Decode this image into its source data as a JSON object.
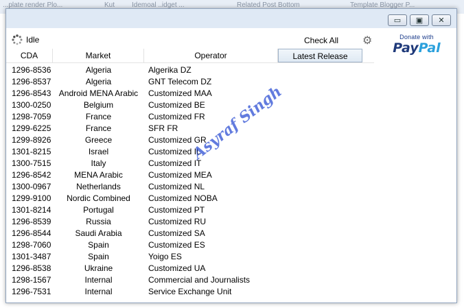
{
  "background_tabs": [
    "...plate render Plo...",
    "Kut",
    "Idemoal ..idget ...",
    "Related Post Bottom",
    "Template Blogger P..."
  ],
  "window": {
    "buttons": {
      "minimize": "▭",
      "maximize": "▣",
      "close": "✕"
    }
  },
  "status": {
    "text": "Idle",
    "icon": "spinner-icon"
  },
  "toolbar": {
    "check_all": "Check All",
    "settings_icon": "gear-icon"
  },
  "donate": {
    "label": "Donate with",
    "logo_part1": "Pay",
    "logo_part2": "Pal"
  },
  "table": {
    "headers": {
      "cda": "CDA",
      "market": "Market",
      "operator": "Operator",
      "release": "Latest Release"
    },
    "rows": [
      {
        "cda": "1296-8536",
        "market": "Algeria",
        "operator": "Algerika DZ"
      },
      {
        "cda": "1296-8537",
        "market": "Algeria",
        "operator": "GNT Telecom DZ"
      },
      {
        "cda": "1296-8543",
        "market": "Android MENA Arabic",
        "operator": "Customized MAA"
      },
      {
        "cda": "1300-0250",
        "market": "Belgium",
        "operator": "Customized BE"
      },
      {
        "cda": "1298-7059",
        "market": "France",
        "operator": "Customized FR"
      },
      {
        "cda": "1299-6225",
        "market": "France",
        "operator": "SFR FR"
      },
      {
        "cda": "1299-8926",
        "market": "Greece",
        "operator": "Customized GR"
      },
      {
        "cda": "1301-8215",
        "market": "Israel",
        "operator": "Customized IL"
      },
      {
        "cda": "1300-7515",
        "market": "Italy",
        "operator": "Customized IT"
      },
      {
        "cda": "1296-8542",
        "market": "MENA Arabic",
        "operator": "Customized MEA"
      },
      {
        "cda": "1300-0967",
        "market": "Netherlands",
        "operator": "Customized NL"
      },
      {
        "cda": "1299-9100",
        "market": "Nordic Combined",
        "operator": "Customized NOBA"
      },
      {
        "cda": "1301-8214",
        "market": "Portugal",
        "operator": "Customized PT"
      },
      {
        "cda": "1296-8539",
        "market": "Russia",
        "operator": "Customized RU"
      },
      {
        "cda": "1296-8544",
        "market": "Saudi Arabia",
        "operator": "Customized SA"
      },
      {
        "cda": "1298-7060",
        "market": "Spain",
        "operator": "Customized ES"
      },
      {
        "cda": "1301-3487",
        "market": "Spain",
        "operator": "Yoigo ES"
      },
      {
        "cda": "1296-8538",
        "market": "Ukraine",
        "operator": "Customized UA"
      },
      {
        "cda": "1298-1567",
        "market": "Internal",
        "operator": "Commercial and Journalists"
      },
      {
        "cda": "1296-7531",
        "market": "Internal",
        "operator": "Service Exchange Unit"
      }
    ]
  },
  "watermark": {
    "text": "Asyraf Singh",
    "color": "#3b5bd6"
  }
}
